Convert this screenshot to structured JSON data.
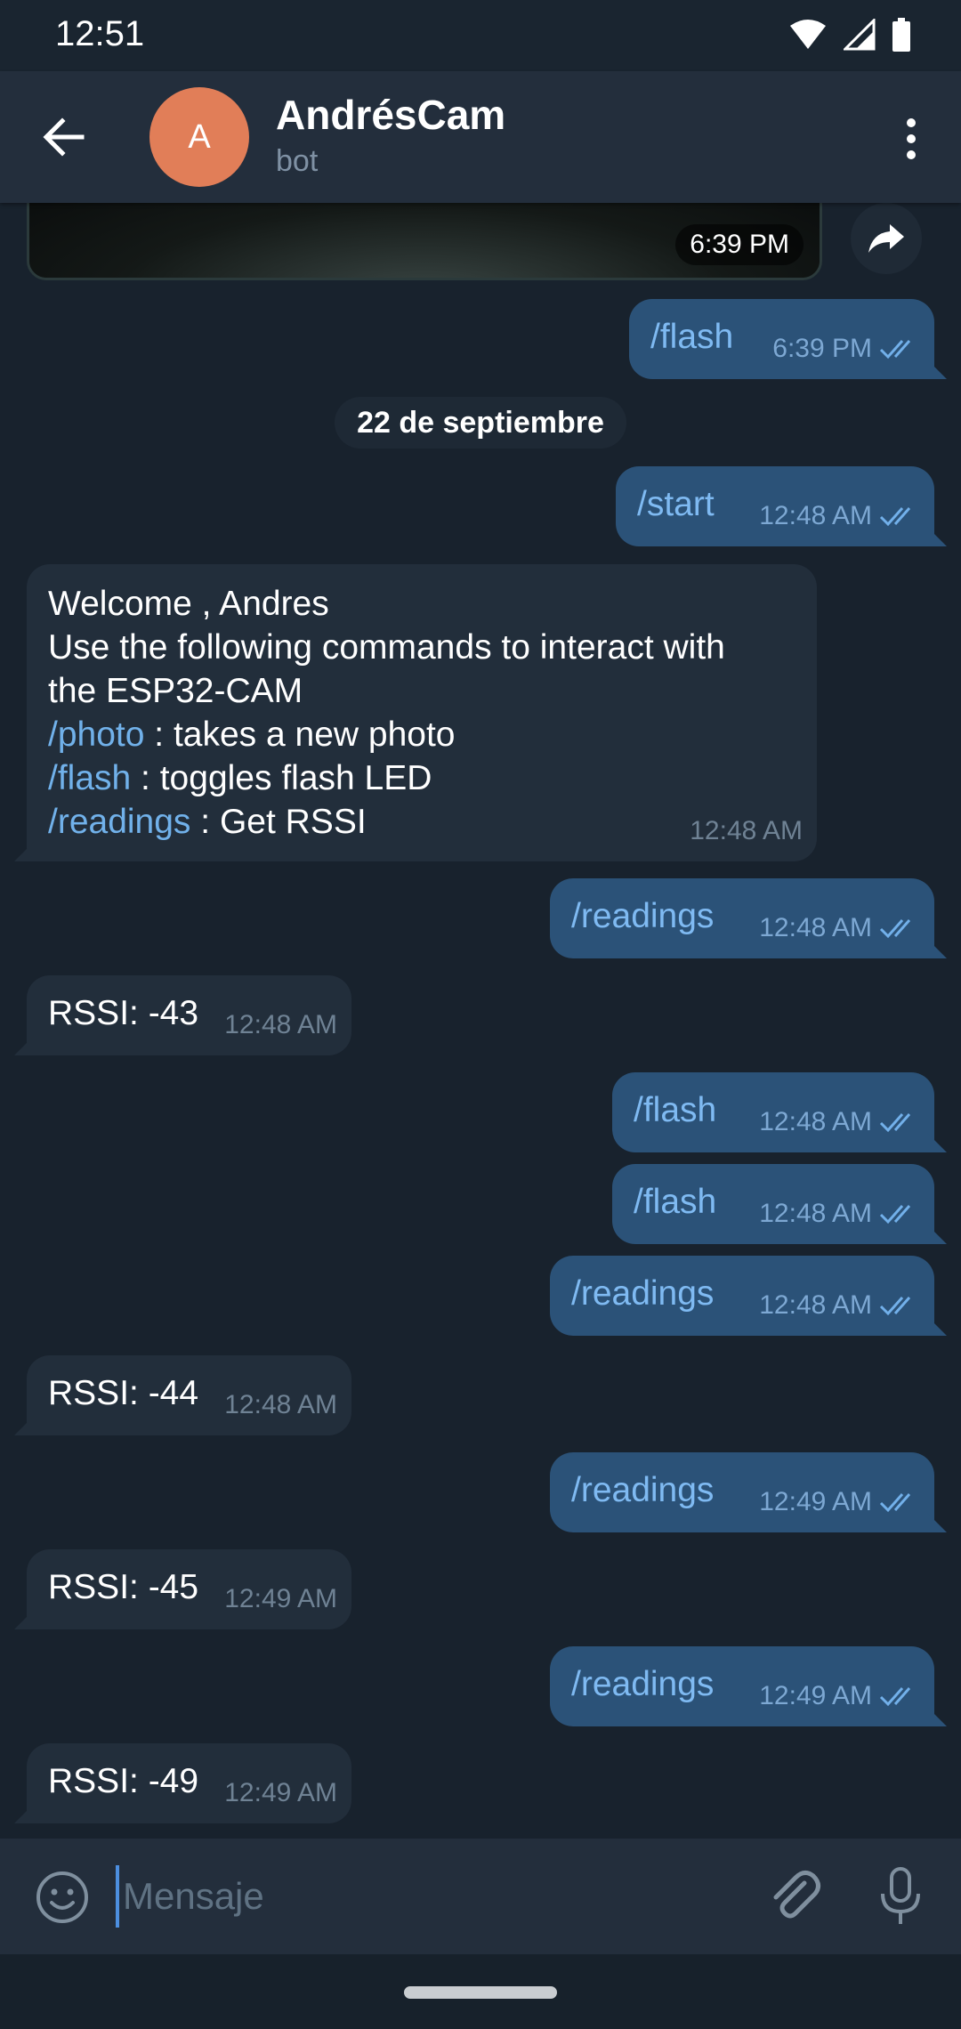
{
  "status": {
    "time": "12:51"
  },
  "header": {
    "avatar_letter": "A",
    "title": "AndrésCam",
    "subtitle": "bot"
  },
  "photo": {
    "time": "6:39 PM"
  },
  "messages": [
    {
      "text": "/flash",
      "time": "6:39 PM"
    },
    {
      "text": "/start",
      "time": "12:48 AM"
    },
    {
      "time": "12:48 AM"
    },
    {
      "text": "/readings",
      "time": "12:48 AM"
    },
    {
      "text": "RSSI: -43",
      "time": "12:48 AM"
    },
    {
      "text": "/flash",
      "time": "12:48 AM"
    },
    {
      "text": "/flash",
      "time": "12:48 AM"
    },
    {
      "text": "/readings",
      "time": "12:48 AM"
    },
    {
      "text": "RSSI: -44",
      "time": "12:48 AM"
    },
    {
      "text": "/readings",
      "time": "12:49 AM"
    },
    {
      "text": "RSSI: -45",
      "time": "12:49 AM"
    },
    {
      "text": "/readings",
      "time": "12:49 AM"
    },
    {
      "text": "RSSI: -49",
      "time": "12:49 AM"
    }
  ],
  "date_separator": "22 de septiembre",
  "welcome": {
    "line1": "Welcome , Andres",
    "line2": "Use the following commands to interact with",
    "line3": "the ESP32-CAM",
    "cmd_photo": "/photo",
    "desc_photo": " : takes a new photo",
    "cmd_flash": "/flash",
    "desc_flash": " : toggles flash LED",
    "cmd_readings": "/readings",
    "desc_readings": " : Get RSSI"
  },
  "composer": {
    "placeholder": "Mensaje"
  },
  "icons": {
    "back": "arrow-left-icon",
    "menu": "more-vert-icon",
    "share": "share-icon",
    "emoji": "emoji-icon",
    "attach": "paperclip-icon",
    "mic": "mic-icon",
    "ticks": "double-check-icon"
  },
  "colors": {
    "outgoing_bubble": "#2b5278",
    "incoming_bubble": "#222e3b",
    "avatar": "#e17e58",
    "command_link": "#71b1ea"
  }
}
